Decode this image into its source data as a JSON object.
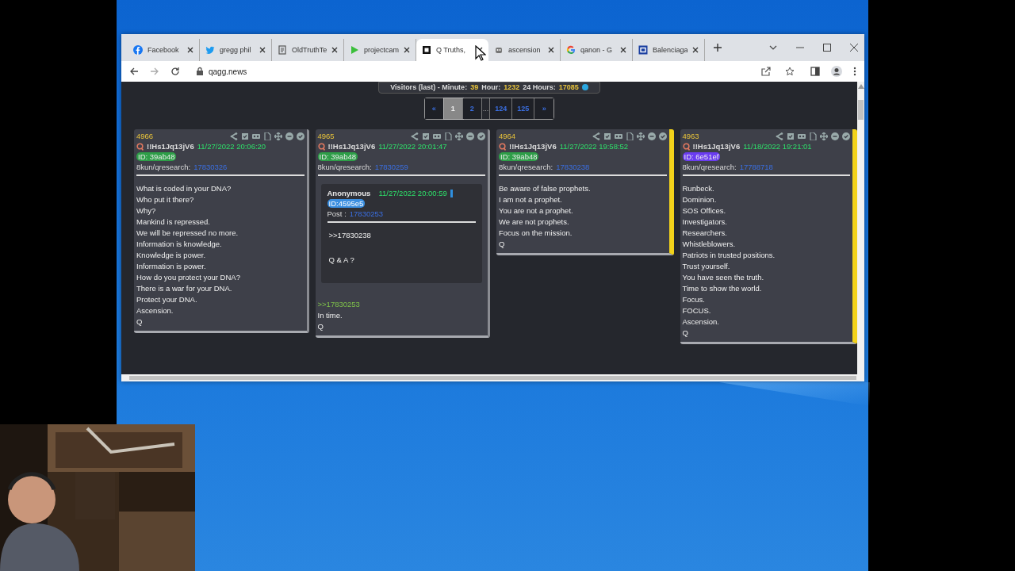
{
  "browser": {
    "tabs": [
      {
        "kind": "facebook",
        "title": "Facebook",
        "selected": false
      },
      {
        "kind": "twitter",
        "title": "gregg phil",
        "selected": false
      },
      {
        "kind": "document",
        "title": "OldTruthTe",
        "selected": false
      },
      {
        "kind": "play",
        "title": "projectcam",
        "selected": false
      },
      {
        "kind": "square",
        "title": "Q Truths,",
        "selected": true
      },
      {
        "kind": "robot",
        "title": "ascension",
        "selected": false
      },
      {
        "kind": "google",
        "title": "qanon - G",
        "selected": false
      },
      {
        "kind": "letter",
        "title": "Balenciaga",
        "selected": false
      }
    ],
    "address": "qagg.news"
  },
  "page": {
    "visitors": [
      {
        "kind": "label",
        "text": "Visitors (last) - Minute:"
      },
      {
        "kind": "value",
        "text": "39"
      },
      {
        "kind": "label",
        "text": "Hour:"
      },
      {
        "kind": "value",
        "text": "1232"
      },
      {
        "kind": "label",
        "text": "24 Hours:"
      },
      {
        "kind": "value",
        "text": "17085"
      }
    ],
    "pagination": [
      {
        "label": "«",
        "selected": false
      },
      {
        "label": "1",
        "selected": true
      },
      {
        "label": "2",
        "selected": false
      },
      {
        "label": "...",
        "kind": "gap"
      },
      {
        "label": "124",
        "selected": false
      },
      {
        "label": "125",
        "selected": false
      },
      {
        "label": "»",
        "selected": false
      }
    ],
    "posts": [
      {
        "number": "4966",
        "tripcode": "!!Hs1Jq13jV6",
        "time": "11/27/2022 20:06:20",
        "id": "ID: 39ab48",
        "color": "#2e9e48",
        "board": "8kun/qresearch:",
        "link": "17830326",
        "highlighted": false,
        "lines": [
          "What is coded in your DNA?",
          "Who put it there?",
          "Why?",
          "Mankind is repressed.",
          "We will be repressed no more.",
          "Information is knowledge.",
          "Knowledge is power.",
          "Information is power.",
          "How do you protect your DNA?",
          "There is a war for your DNA.",
          "Protect your DNA.",
          "Ascension.",
          "Q"
        ]
      },
      {
        "number": "4965",
        "tripcode": "!!Hs1Jq13jV6",
        "time": "11/27/2022 20:01:47",
        "id": "ID: 39ab48",
        "color": "#2e9e48",
        "board": "8kun/qresearch:",
        "link": "17830259",
        "highlighted": false,
        "quote": {
          "author": "Anonymous",
          "time": "11/27/2022 20:00:59",
          "id": "ID:4595e5",
          "post_label": "Post :",
          "post_link": "17830253",
          "lines": [
            ">>17830238",
            "Q & A ?"
          ]
        },
        "reply_ref": ">>17830253",
        "lines": [
          "In time.",
          "Q"
        ]
      },
      {
        "number": "4964",
        "tripcode": "!!Hs1Jq13jV6",
        "time": "11/27/2022 19:58:52",
        "id": "ID: 39ab48",
        "color": "#2e9e48",
        "board": "8kun/qresearch:",
        "link": "17830238",
        "highlighted": true,
        "lines": [
          "Be aware of false prophets.",
          "I am not a prophet.",
          "You are not a prophet.",
          "We are not prophets.",
          "Focus on the mission.",
          "Q"
        ]
      },
      {
        "number": "4963",
        "tripcode": "!!Hs1Jq13jV6",
        "time": "11/18/2022 19:21:01",
        "id": "ID: 6e51ef",
        "color": "#6a3cf0",
        "board": "8kun/qresearch:",
        "link": "17788718",
        "highlighted": true,
        "lines": [
          "Runbeck.",
          "Dominion.",
          "SOS Offices.",
          "Investigators.",
          "Researchers.",
          "Whistleblowers.",
          "Patriots in trusted positions.",
          "Trust yourself.",
          "You have seen the truth.",
          "Time to show the world.",
          "Focus.",
          "FOCUS.",
          "Ascension.",
          "Q"
        ]
      }
    ]
  }
}
